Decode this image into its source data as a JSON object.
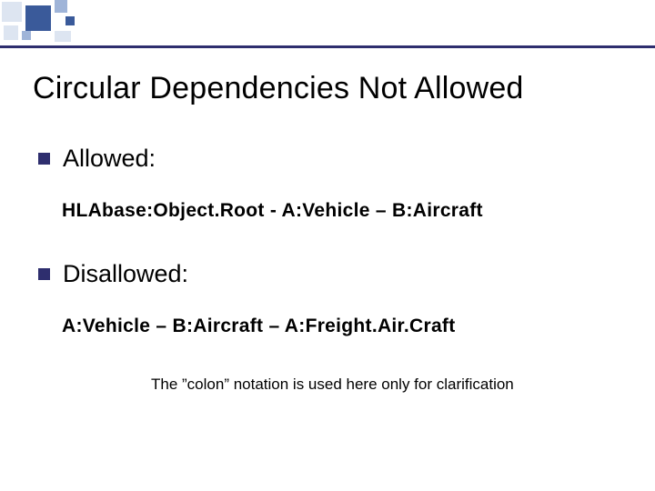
{
  "slide": {
    "title": "Circular Dependencies Not Allowed",
    "bullets": [
      {
        "label": "Allowed:",
        "example": "HLAbase:Object.Root - A:Vehicle – B:Aircraft"
      },
      {
        "label": "Disallowed:",
        "example": "A:Vehicle – B:Aircraft – A:Freight.Air.Craft"
      }
    ],
    "footnote": "The ”colon” notation is used here only for clarification"
  }
}
